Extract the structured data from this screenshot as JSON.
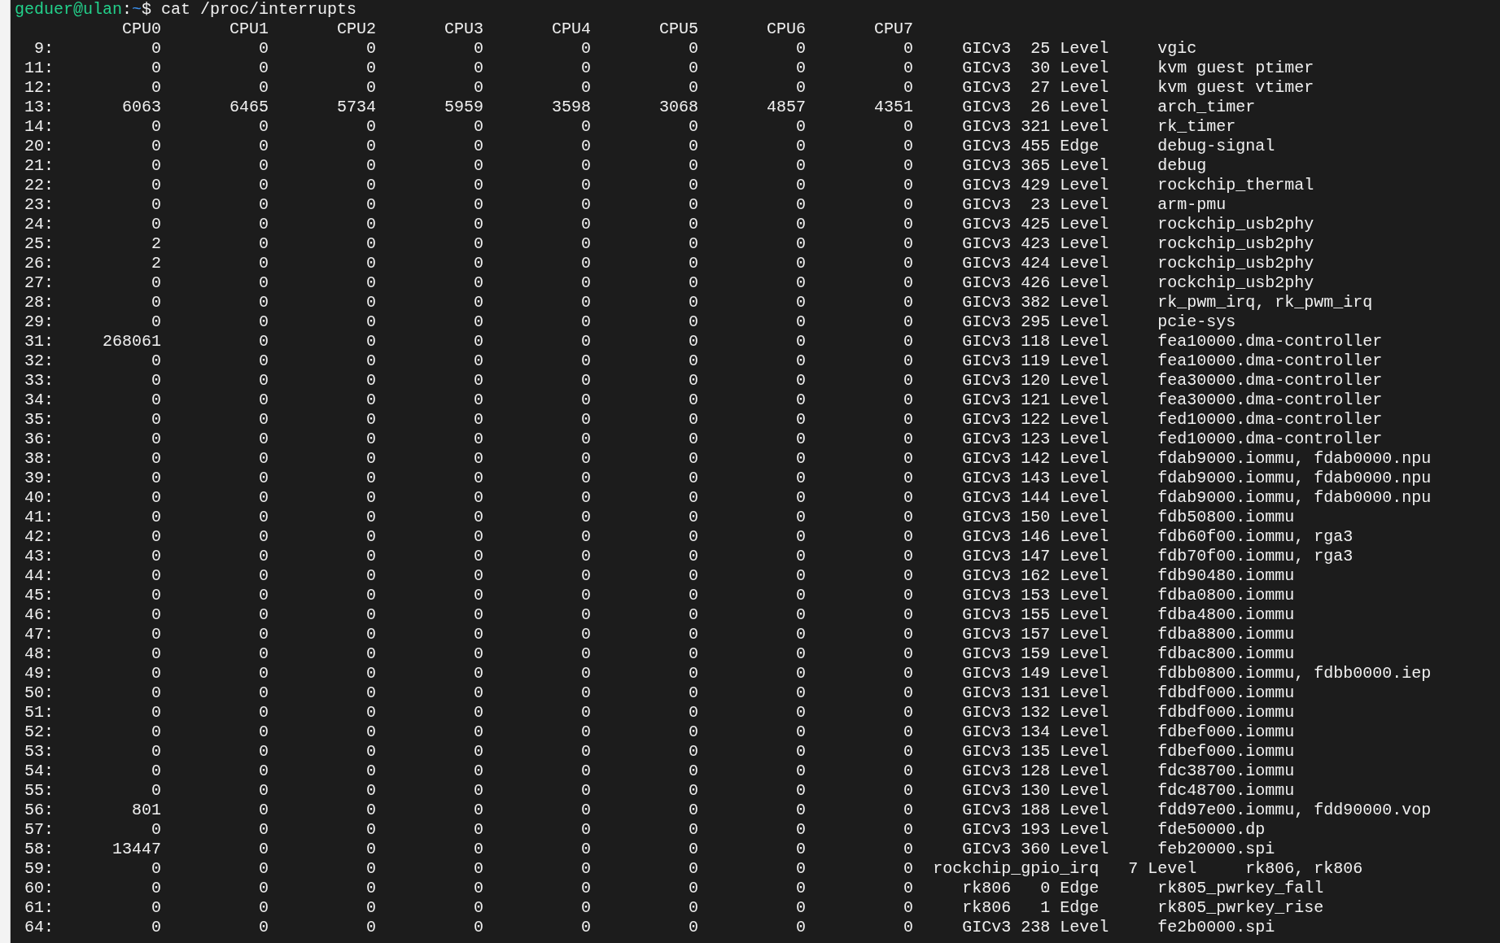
{
  "prompt": {
    "user_host": "geduer@ulan",
    "separator": ":",
    "path": "~",
    "command": "$ cat /proc/interrupts"
  },
  "cpus": [
    "CPU0",
    "CPU1",
    "CPU2",
    "CPU3",
    "CPU4",
    "CPU5",
    "CPU6",
    "CPU7"
  ],
  "rows": [
    {
      "irq": "9:",
      "counts": [
        "0",
        "0",
        "0",
        "0",
        "0",
        "0",
        "0",
        "0"
      ],
      "chip": "GICv3",
      "hwirq": "25",
      "type": "Level",
      "name": "vgic"
    },
    {
      "irq": "11:",
      "counts": [
        "0",
        "0",
        "0",
        "0",
        "0",
        "0",
        "0",
        "0"
      ],
      "chip": "GICv3",
      "hwirq": "30",
      "type": "Level",
      "name": "kvm guest ptimer"
    },
    {
      "irq": "12:",
      "counts": [
        "0",
        "0",
        "0",
        "0",
        "0",
        "0",
        "0",
        "0"
      ],
      "chip": "GICv3",
      "hwirq": "27",
      "type": "Level",
      "name": "kvm guest vtimer"
    },
    {
      "irq": "13:",
      "counts": [
        "6063",
        "6465",
        "5734",
        "5959",
        "3598",
        "3068",
        "4857",
        "4351"
      ],
      "chip": "GICv3",
      "hwirq": "26",
      "type": "Level",
      "name": "arch_timer"
    },
    {
      "irq": "14:",
      "counts": [
        "0",
        "0",
        "0",
        "0",
        "0",
        "0",
        "0",
        "0"
      ],
      "chip": "GICv3",
      "hwirq": "321",
      "type": "Level",
      "name": "rk_timer"
    },
    {
      "irq": "20:",
      "counts": [
        "0",
        "0",
        "0",
        "0",
        "0",
        "0",
        "0",
        "0"
      ],
      "chip": "GICv3",
      "hwirq": "455",
      "type": "Edge",
      "name": "debug-signal"
    },
    {
      "irq": "21:",
      "counts": [
        "0",
        "0",
        "0",
        "0",
        "0",
        "0",
        "0",
        "0"
      ],
      "chip": "GICv3",
      "hwirq": "365",
      "type": "Level",
      "name": "debug"
    },
    {
      "irq": "22:",
      "counts": [
        "0",
        "0",
        "0",
        "0",
        "0",
        "0",
        "0",
        "0"
      ],
      "chip": "GICv3",
      "hwirq": "429",
      "type": "Level",
      "name": "rockchip_thermal"
    },
    {
      "irq": "23:",
      "counts": [
        "0",
        "0",
        "0",
        "0",
        "0",
        "0",
        "0",
        "0"
      ],
      "chip": "GICv3",
      "hwirq": "23",
      "type": "Level",
      "name": "arm-pmu"
    },
    {
      "irq": "24:",
      "counts": [
        "0",
        "0",
        "0",
        "0",
        "0",
        "0",
        "0",
        "0"
      ],
      "chip": "GICv3",
      "hwirq": "425",
      "type": "Level",
      "name": "rockchip_usb2phy"
    },
    {
      "irq": "25:",
      "counts": [
        "2",
        "0",
        "0",
        "0",
        "0",
        "0",
        "0",
        "0"
      ],
      "chip": "GICv3",
      "hwirq": "423",
      "type": "Level",
      "name": "rockchip_usb2phy"
    },
    {
      "irq": "26:",
      "counts": [
        "2",
        "0",
        "0",
        "0",
        "0",
        "0",
        "0",
        "0"
      ],
      "chip": "GICv3",
      "hwirq": "424",
      "type": "Level",
      "name": "rockchip_usb2phy"
    },
    {
      "irq": "27:",
      "counts": [
        "0",
        "0",
        "0",
        "0",
        "0",
        "0",
        "0",
        "0"
      ],
      "chip": "GICv3",
      "hwirq": "426",
      "type": "Level",
      "name": "rockchip_usb2phy"
    },
    {
      "irq": "28:",
      "counts": [
        "0",
        "0",
        "0",
        "0",
        "0",
        "0",
        "0",
        "0"
      ],
      "chip": "GICv3",
      "hwirq": "382",
      "type": "Level",
      "name": "rk_pwm_irq, rk_pwm_irq"
    },
    {
      "irq": "29:",
      "counts": [
        "0",
        "0",
        "0",
        "0",
        "0",
        "0",
        "0",
        "0"
      ],
      "chip": "GICv3",
      "hwirq": "295",
      "type": "Level",
      "name": "pcie-sys"
    },
    {
      "irq": "31:",
      "counts": [
        "268061",
        "0",
        "0",
        "0",
        "0",
        "0",
        "0",
        "0"
      ],
      "chip": "GICv3",
      "hwirq": "118",
      "type": "Level",
      "name": "fea10000.dma-controller"
    },
    {
      "irq": "32:",
      "counts": [
        "0",
        "0",
        "0",
        "0",
        "0",
        "0",
        "0",
        "0"
      ],
      "chip": "GICv3",
      "hwirq": "119",
      "type": "Level",
      "name": "fea10000.dma-controller"
    },
    {
      "irq": "33:",
      "counts": [
        "0",
        "0",
        "0",
        "0",
        "0",
        "0",
        "0",
        "0"
      ],
      "chip": "GICv3",
      "hwirq": "120",
      "type": "Level",
      "name": "fea30000.dma-controller"
    },
    {
      "irq": "34:",
      "counts": [
        "0",
        "0",
        "0",
        "0",
        "0",
        "0",
        "0",
        "0"
      ],
      "chip": "GICv3",
      "hwirq": "121",
      "type": "Level",
      "name": "fea30000.dma-controller"
    },
    {
      "irq": "35:",
      "counts": [
        "0",
        "0",
        "0",
        "0",
        "0",
        "0",
        "0",
        "0"
      ],
      "chip": "GICv3",
      "hwirq": "122",
      "type": "Level",
      "name": "fed10000.dma-controller"
    },
    {
      "irq": "36:",
      "counts": [
        "0",
        "0",
        "0",
        "0",
        "0",
        "0",
        "0",
        "0"
      ],
      "chip": "GICv3",
      "hwirq": "123",
      "type": "Level",
      "name": "fed10000.dma-controller"
    },
    {
      "irq": "38:",
      "counts": [
        "0",
        "0",
        "0",
        "0",
        "0",
        "0",
        "0",
        "0"
      ],
      "chip": "GICv3",
      "hwirq": "142",
      "type": "Level",
      "name": "fdab9000.iommu, fdab0000.npu"
    },
    {
      "irq": "39:",
      "counts": [
        "0",
        "0",
        "0",
        "0",
        "0",
        "0",
        "0",
        "0"
      ],
      "chip": "GICv3",
      "hwirq": "143",
      "type": "Level",
      "name": "fdab9000.iommu, fdab0000.npu"
    },
    {
      "irq": "40:",
      "counts": [
        "0",
        "0",
        "0",
        "0",
        "0",
        "0",
        "0",
        "0"
      ],
      "chip": "GICv3",
      "hwirq": "144",
      "type": "Level",
      "name": "fdab9000.iommu, fdab0000.npu"
    },
    {
      "irq": "41:",
      "counts": [
        "0",
        "0",
        "0",
        "0",
        "0",
        "0",
        "0",
        "0"
      ],
      "chip": "GICv3",
      "hwirq": "150",
      "type": "Level",
      "name": "fdb50800.iommu"
    },
    {
      "irq": "42:",
      "counts": [
        "0",
        "0",
        "0",
        "0",
        "0",
        "0",
        "0",
        "0"
      ],
      "chip": "GICv3",
      "hwirq": "146",
      "type": "Level",
      "name": "fdb60f00.iommu, rga3"
    },
    {
      "irq": "43:",
      "counts": [
        "0",
        "0",
        "0",
        "0",
        "0",
        "0",
        "0",
        "0"
      ],
      "chip": "GICv3",
      "hwirq": "147",
      "type": "Level",
      "name": "fdb70f00.iommu, rga3"
    },
    {
      "irq": "44:",
      "counts": [
        "0",
        "0",
        "0",
        "0",
        "0",
        "0",
        "0",
        "0"
      ],
      "chip": "GICv3",
      "hwirq": "162",
      "type": "Level",
      "name": "fdb90480.iommu"
    },
    {
      "irq": "45:",
      "counts": [
        "0",
        "0",
        "0",
        "0",
        "0",
        "0",
        "0",
        "0"
      ],
      "chip": "GICv3",
      "hwirq": "153",
      "type": "Level",
      "name": "fdba0800.iommu"
    },
    {
      "irq": "46:",
      "counts": [
        "0",
        "0",
        "0",
        "0",
        "0",
        "0",
        "0",
        "0"
      ],
      "chip": "GICv3",
      "hwirq": "155",
      "type": "Level",
      "name": "fdba4800.iommu"
    },
    {
      "irq": "47:",
      "counts": [
        "0",
        "0",
        "0",
        "0",
        "0",
        "0",
        "0",
        "0"
      ],
      "chip": "GICv3",
      "hwirq": "157",
      "type": "Level",
      "name": "fdba8800.iommu"
    },
    {
      "irq": "48:",
      "counts": [
        "0",
        "0",
        "0",
        "0",
        "0",
        "0",
        "0",
        "0"
      ],
      "chip": "GICv3",
      "hwirq": "159",
      "type": "Level",
      "name": "fdbac800.iommu"
    },
    {
      "irq": "49:",
      "counts": [
        "0",
        "0",
        "0",
        "0",
        "0",
        "0",
        "0",
        "0"
      ],
      "chip": "GICv3",
      "hwirq": "149",
      "type": "Level",
      "name": "fdbb0800.iommu, fdbb0000.iep"
    },
    {
      "irq": "50:",
      "counts": [
        "0",
        "0",
        "0",
        "0",
        "0",
        "0",
        "0",
        "0"
      ],
      "chip": "GICv3",
      "hwirq": "131",
      "type": "Level",
      "name": "fdbdf000.iommu"
    },
    {
      "irq": "51:",
      "counts": [
        "0",
        "0",
        "0",
        "0",
        "0",
        "0",
        "0",
        "0"
      ],
      "chip": "GICv3",
      "hwirq": "132",
      "type": "Level",
      "name": "fdbdf000.iommu"
    },
    {
      "irq": "52:",
      "counts": [
        "0",
        "0",
        "0",
        "0",
        "0",
        "0",
        "0",
        "0"
      ],
      "chip": "GICv3",
      "hwirq": "134",
      "type": "Level",
      "name": "fdbef000.iommu"
    },
    {
      "irq": "53:",
      "counts": [
        "0",
        "0",
        "0",
        "0",
        "0",
        "0",
        "0",
        "0"
      ],
      "chip": "GICv3",
      "hwirq": "135",
      "type": "Level",
      "name": "fdbef000.iommu"
    },
    {
      "irq": "54:",
      "counts": [
        "0",
        "0",
        "0",
        "0",
        "0",
        "0",
        "0",
        "0"
      ],
      "chip": "GICv3",
      "hwirq": "128",
      "type": "Level",
      "name": "fdc38700.iommu"
    },
    {
      "irq": "55:",
      "counts": [
        "0",
        "0",
        "0",
        "0",
        "0",
        "0",
        "0",
        "0"
      ],
      "chip": "GICv3",
      "hwirq": "130",
      "type": "Level",
      "name": "fdc48700.iommu"
    },
    {
      "irq": "56:",
      "counts": [
        "801",
        "0",
        "0",
        "0",
        "0",
        "0",
        "0",
        "0"
      ],
      "chip": "GICv3",
      "hwirq": "188",
      "type": "Level",
      "name": "fdd97e00.iommu, fdd90000.vop"
    },
    {
      "irq": "57:",
      "counts": [
        "0",
        "0",
        "0",
        "0",
        "0",
        "0",
        "0",
        "0"
      ],
      "chip": "GICv3",
      "hwirq": "193",
      "type": "Level",
      "name": "fde50000.dp"
    },
    {
      "irq": "58:",
      "counts": [
        "13447",
        "0",
        "0",
        "0",
        "0",
        "0",
        "0",
        "0"
      ],
      "chip": "GICv3",
      "hwirq": "360",
      "type": "Level",
      "name": "feb20000.spi"
    },
    {
      "irq": "59:",
      "counts": [
        "0",
        "0",
        "0",
        "0",
        "0",
        "0",
        "0",
        "0"
      ],
      "chip": "rockchip_gpio_irq",
      "hwirq": "7",
      "type": "Level",
      "name": "rk806, rk806"
    },
    {
      "irq": "60:",
      "counts": [
        "0",
        "0",
        "0",
        "0",
        "0",
        "0",
        "0",
        "0"
      ],
      "chip": "rk806",
      "hwirq": "0",
      "type": "Edge",
      "name": "rk805_pwrkey_fall"
    },
    {
      "irq": "61:",
      "counts": [
        "0",
        "0",
        "0",
        "0",
        "0",
        "0",
        "0",
        "0"
      ],
      "chip": "rk806",
      "hwirq": "1",
      "type": "Edge",
      "name": "rk805_pwrkey_rise"
    },
    {
      "irq": "64:",
      "counts": [
        "0",
        "0",
        "0",
        "0",
        "0",
        "0",
        "0",
        "0"
      ],
      "chip": "GICv3",
      "hwirq": "238",
      "type": "Level",
      "name": "fe2b0000.spi"
    }
  ]
}
